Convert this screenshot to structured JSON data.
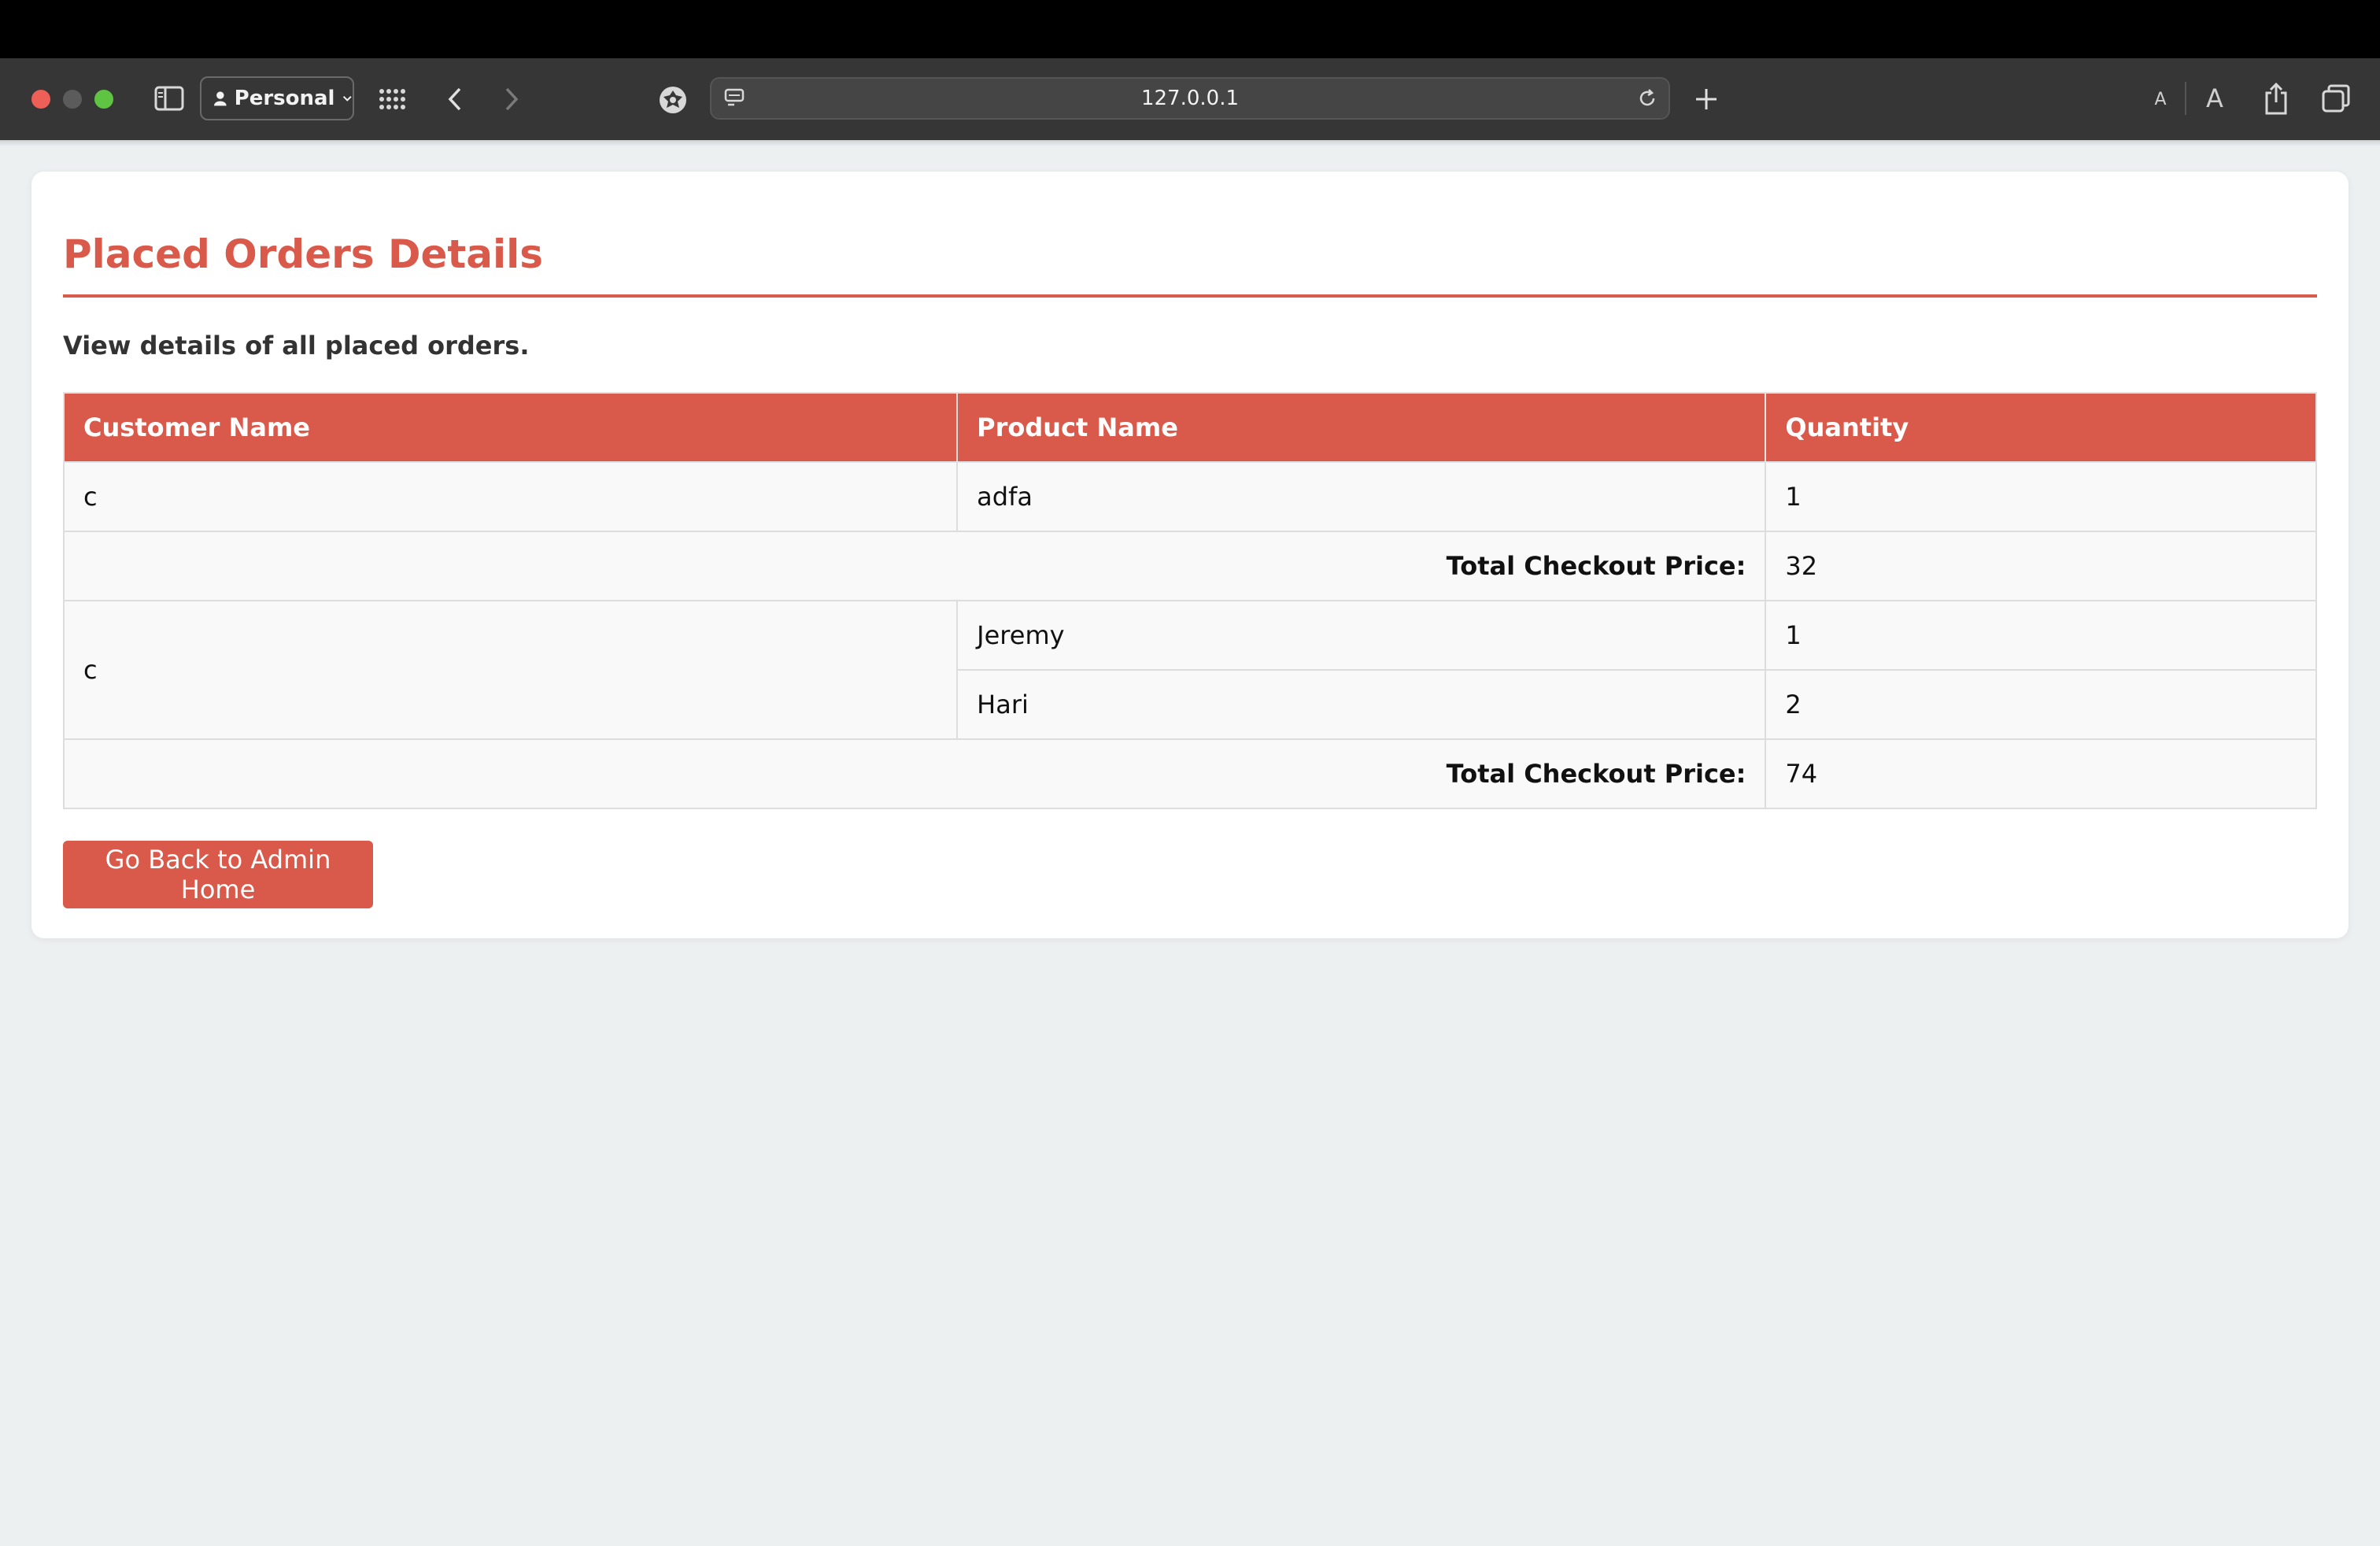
{
  "browser": {
    "profile_label": "Personal",
    "url": "127.0.0.1",
    "text_small_label": "A",
    "text_large_label": "A"
  },
  "page": {
    "title": "Placed Orders Details",
    "subtitle": "View details of all placed orders.",
    "table": {
      "headers": [
        "Customer Name",
        "Product Name",
        "Quantity"
      ],
      "orders": [
        {
          "customer": "c",
          "items": [
            {
              "product": "adfa",
              "quantity": "1"
            }
          ],
          "total_label": "Total Checkout Price:",
          "total": "32"
        },
        {
          "customer": "c",
          "items": [
            {
              "product": "Jeremy",
              "quantity": "1"
            },
            {
              "product": "Hari",
              "quantity": "2"
            }
          ],
          "total_label": "Total Checkout Price:",
          "total": "74"
        }
      ]
    },
    "back_button_label": "Go Back to Admin Home"
  },
  "colors": {
    "accent": "#d9594a",
    "page_bg": "#ecf0f1",
    "toolbar_bg": "#363636"
  }
}
